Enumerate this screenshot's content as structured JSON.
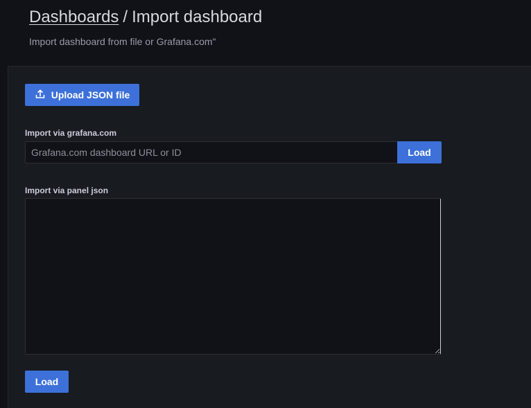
{
  "header": {
    "breadcrumb_link": "Dashboards",
    "separator": "/",
    "title": "Import dashboard",
    "subtitle": "Import dashboard from file or Grafana.com\""
  },
  "upload": {
    "label": "Upload JSON file",
    "icon": "upload-icon"
  },
  "grafana_com": {
    "label": "Import via grafana.com",
    "placeholder": "Grafana.com dashboard URL or ID",
    "value": "",
    "button_label": "Load"
  },
  "panel_json": {
    "label": "Import via panel json",
    "value": "",
    "button_label": "Load"
  },
  "colors": {
    "primary": "#3d71d9",
    "background": "#111217",
    "panel": "#181b1f"
  }
}
